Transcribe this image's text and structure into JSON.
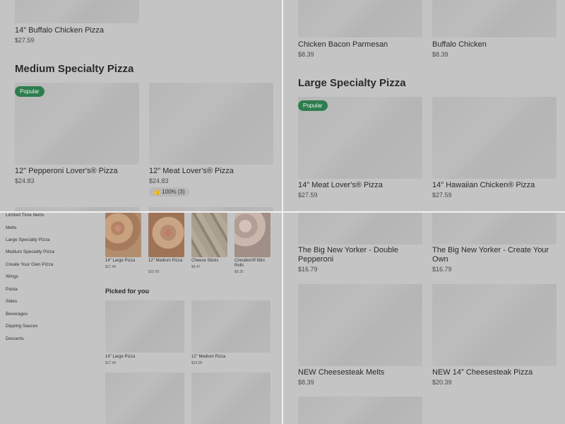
{
  "top_left": {
    "first_item": {
      "name": "14\" Buffalo Chicken Pizza",
      "price": "$27.59"
    },
    "section_title": "Medium Specialty Pizza",
    "badge": "Popular",
    "items": [
      {
        "name": "12\" Pepperoni Lover's® Pizza",
        "price": "$24.83"
      },
      {
        "name": "12\" Meat Lover's® Pizza",
        "price": "$24.83",
        "rating": "100% (3)"
      }
    ]
  },
  "top_right": {
    "first_items": [
      {
        "name": "Chicken Bacon Parmesan",
        "price": "$8.39"
      },
      {
        "name": "Buffalo Chicken",
        "price": "$8.39"
      }
    ],
    "section_title": "Large Specialty Pizza",
    "badge": "Popular",
    "items": [
      {
        "name": "14\" Meat Lover's® Pizza",
        "price": "$27.59"
      },
      {
        "name": "14\" Hawaiian Chicken® Pizza",
        "price": "$27.59"
      }
    ]
  },
  "bottom_left": {
    "categories": [
      "Limited Time Items",
      "Melts",
      "Large Specialty Pizza",
      "Medium Specialty Pizza",
      "Create Your Own Pizza",
      "Wings",
      "Pasta",
      "Sides",
      "Beverages",
      "Dipping Sauces",
      "Desserts"
    ],
    "thumbs": [
      {
        "name": "14\" Large Pizza",
        "price": "$17.45"
      },
      {
        "name": "12\" Medium Pizza",
        "price": "$15.05"
      },
      {
        "name": "Cheese Sticks",
        "price": "$9.47"
      },
      {
        "name": "Cinnabon® Mini Rolls",
        "price": "$9.35"
      }
    ],
    "picked_title": "Picked for you",
    "picked": [
      {
        "name": "14\" Large Pizza",
        "price": "$17.45"
      },
      {
        "name": "12\" Medium Pizza",
        "price": "$15.05"
      }
    ]
  },
  "bottom_right": {
    "items": [
      {
        "name": "The Big New Yorker - Double Pepperoni",
        "price": "$16.79"
      },
      {
        "name": "The Big New Yorker - Create Your Own",
        "price": "$16.79"
      },
      {
        "name": "NEW Cheesesteak Melts",
        "price": "$8.39"
      },
      {
        "name": "NEW 14\" Cheesesteak Pizza",
        "price": "$20.39"
      }
    ]
  }
}
